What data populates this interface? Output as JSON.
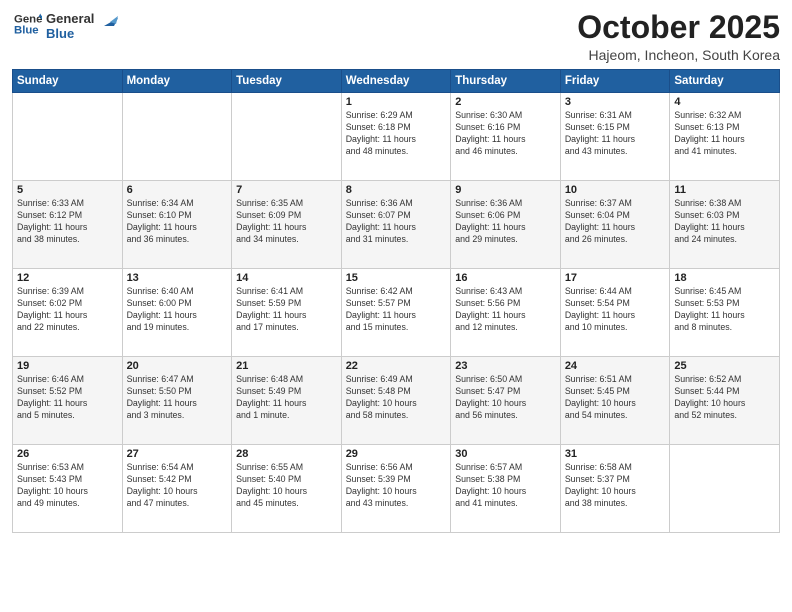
{
  "header": {
    "logo_general": "General",
    "logo_blue": "Blue",
    "title": "October 2025",
    "subtitle": "Hajeom, Incheon, South Korea"
  },
  "days_of_week": [
    "Sunday",
    "Monday",
    "Tuesday",
    "Wednesday",
    "Thursday",
    "Friday",
    "Saturday"
  ],
  "weeks": [
    [
      {
        "day": "",
        "info": ""
      },
      {
        "day": "",
        "info": ""
      },
      {
        "day": "",
        "info": ""
      },
      {
        "day": "1",
        "info": "Sunrise: 6:29 AM\nSunset: 6:18 PM\nDaylight: 11 hours\nand 48 minutes."
      },
      {
        "day": "2",
        "info": "Sunrise: 6:30 AM\nSunset: 6:16 PM\nDaylight: 11 hours\nand 46 minutes."
      },
      {
        "day": "3",
        "info": "Sunrise: 6:31 AM\nSunset: 6:15 PM\nDaylight: 11 hours\nand 43 minutes."
      },
      {
        "day": "4",
        "info": "Sunrise: 6:32 AM\nSunset: 6:13 PM\nDaylight: 11 hours\nand 41 minutes."
      }
    ],
    [
      {
        "day": "5",
        "info": "Sunrise: 6:33 AM\nSunset: 6:12 PM\nDaylight: 11 hours\nand 38 minutes."
      },
      {
        "day": "6",
        "info": "Sunrise: 6:34 AM\nSunset: 6:10 PM\nDaylight: 11 hours\nand 36 minutes."
      },
      {
        "day": "7",
        "info": "Sunrise: 6:35 AM\nSunset: 6:09 PM\nDaylight: 11 hours\nand 34 minutes."
      },
      {
        "day": "8",
        "info": "Sunrise: 6:36 AM\nSunset: 6:07 PM\nDaylight: 11 hours\nand 31 minutes."
      },
      {
        "day": "9",
        "info": "Sunrise: 6:36 AM\nSunset: 6:06 PM\nDaylight: 11 hours\nand 29 minutes."
      },
      {
        "day": "10",
        "info": "Sunrise: 6:37 AM\nSunset: 6:04 PM\nDaylight: 11 hours\nand 26 minutes."
      },
      {
        "day": "11",
        "info": "Sunrise: 6:38 AM\nSunset: 6:03 PM\nDaylight: 11 hours\nand 24 minutes."
      }
    ],
    [
      {
        "day": "12",
        "info": "Sunrise: 6:39 AM\nSunset: 6:02 PM\nDaylight: 11 hours\nand 22 minutes."
      },
      {
        "day": "13",
        "info": "Sunrise: 6:40 AM\nSunset: 6:00 PM\nDaylight: 11 hours\nand 19 minutes."
      },
      {
        "day": "14",
        "info": "Sunrise: 6:41 AM\nSunset: 5:59 PM\nDaylight: 11 hours\nand 17 minutes."
      },
      {
        "day": "15",
        "info": "Sunrise: 6:42 AM\nSunset: 5:57 PM\nDaylight: 11 hours\nand 15 minutes."
      },
      {
        "day": "16",
        "info": "Sunrise: 6:43 AM\nSunset: 5:56 PM\nDaylight: 11 hours\nand 12 minutes."
      },
      {
        "day": "17",
        "info": "Sunrise: 6:44 AM\nSunset: 5:54 PM\nDaylight: 11 hours\nand 10 minutes."
      },
      {
        "day": "18",
        "info": "Sunrise: 6:45 AM\nSunset: 5:53 PM\nDaylight: 11 hours\nand 8 minutes."
      }
    ],
    [
      {
        "day": "19",
        "info": "Sunrise: 6:46 AM\nSunset: 5:52 PM\nDaylight: 11 hours\nand 5 minutes."
      },
      {
        "day": "20",
        "info": "Sunrise: 6:47 AM\nSunset: 5:50 PM\nDaylight: 11 hours\nand 3 minutes."
      },
      {
        "day": "21",
        "info": "Sunrise: 6:48 AM\nSunset: 5:49 PM\nDaylight: 11 hours\nand 1 minute."
      },
      {
        "day": "22",
        "info": "Sunrise: 6:49 AM\nSunset: 5:48 PM\nDaylight: 10 hours\nand 58 minutes."
      },
      {
        "day": "23",
        "info": "Sunrise: 6:50 AM\nSunset: 5:47 PM\nDaylight: 10 hours\nand 56 minutes."
      },
      {
        "day": "24",
        "info": "Sunrise: 6:51 AM\nSunset: 5:45 PM\nDaylight: 10 hours\nand 54 minutes."
      },
      {
        "day": "25",
        "info": "Sunrise: 6:52 AM\nSunset: 5:44 PM\nDaylight: 10 hours\nand 52 minutes."
      }
    ],
    [
      {
        "day": "26",
        "info": "Sunrise: 6:53 AM\nSunset: 5:43 PM\nDaylight: 10 hours\nand 49 minutes."
      },
      {
        "day": "27",
        "info": "Sunrise: 6:54 AM\nSunset: 5:42 PM\nDaylight: 10 hours\nand 47 minutes."
      },
      {
        "day": "28",
        "info": "Sunrise: 6:55 AM\nSunset: 5:40 PM\nDaylight: 10 hours\nand 45 minutes."
      },
      {
        "day": "29",
        "info": "Sunrise: 6:56 AM\nSunset: 5:39 PM\nDaylight: 10 hours\nand 43 minutes."
      },
      {
        "day": "30",
        "info": "Sunrise: 6:57 AM\nSunset: 5:38 PM\nDaylight: 10 hours\nand 41 minutes."
      },
      {
        "day": "31",
        "info": "Sunrise: 6:58 AM\nSunset: 5:37 PM\nDaylight: 10 hours\nand 38 minutes."
      },
      {
        "day": "",
        "info": ""
      }
    ]
  ]
}
